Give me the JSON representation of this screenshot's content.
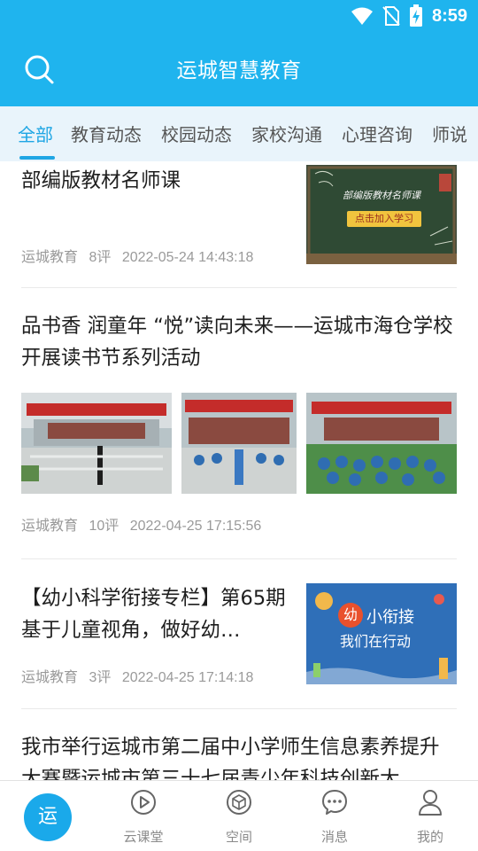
{
  "status_bar": {
    "time": "8:59"
  },
  "header": {
    "title": "运城智慧教育"
  },
  "tabs": [
    {
      "label": "全部"
    },
    {
      "label": "教育动态"
    },
    {
      "label": "校园动态"
    },
    {
      "label": "家校沟通"
    },
    {
      "label": "心理咨询"
    },
    {
      "label": "师说"
    }
  ],
  "feed": {
    "items": [
      {
        "title": "部编版教材名师课",
        "source": "运城教育",
        "comments": "8评",
        "time": "2022-05-24 14:43:18",
        "thumb_text_1": "部编版教材名师课",
        "thumb_text_2": "点击加入学习"
      },
      {
        "title": "品书香 润童年 “悦”读向未来——运城市海仓学校开展读书节系列活动",
        "source": "运城教育",
        "comments": "10评",
        "time": "2022-04-25 17:15:56"
      },
      {
        "title": "【幼小科学衔接专栏】第65期 基于儿童视角，做好幼…",
        "source": "运城教育",
        "comments": "3评",
        "time": "2022-04-25 17:14:18",
        "thumb_text_1": "幼",
        "thumb_text_2": "小衔接",
        "thumb_text_3": "我们在行动"
      },
      {
        "title": "我市举行运城市第二届中小学师生信息素养提升大赛暨运城市第三十七届青少年科技创新大"
      }
    ]
  },
  "bottom_nav": {
    "home_label": "运",
    "items": [
      {
        "label": "云课堂"
      },
      {
        "label": "空间"
      },
      {
        "label": "消息"
      },
      {
        "label": "我的"
      }
    ]
  }
}
